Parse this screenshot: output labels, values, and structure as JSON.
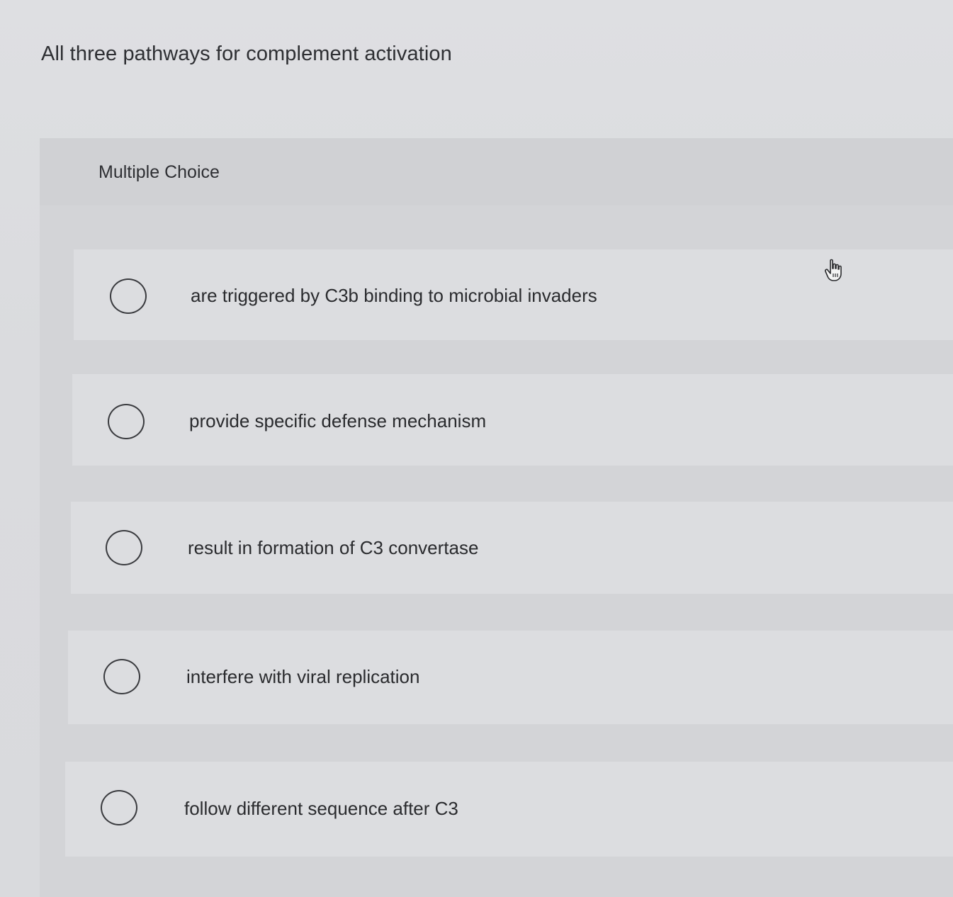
{
  "question": {
    "text": "All three pathways for complement activation"
  },
  "multiple_choice": {
    "label": "Multiple Choice",
    "options": [
      {
        "text": "are triggered by C3b binding to microbial invaders",
        "selected": false
      },
      {
        "text": "provide specific defense mechanism",
        "selected": false
      },
      {
        "text": "result in formation of C3 convertase",
        "selected": false
      },
      {
        "text": "interfere with viral replication",
        "selected": false
      },
      {
        "text": "follow different sequence after C3",
        "selected": false
      }
    ]
  },
  "cursor": {
    "icon": "hand-pointer-icon"
  },
  "colors": {
    "background": "#dcdde0",
    "panel": "#d3d4d7",
    "text": "#2a2b2e",
    "radio_border": "#3a3b3f"
  }
}
